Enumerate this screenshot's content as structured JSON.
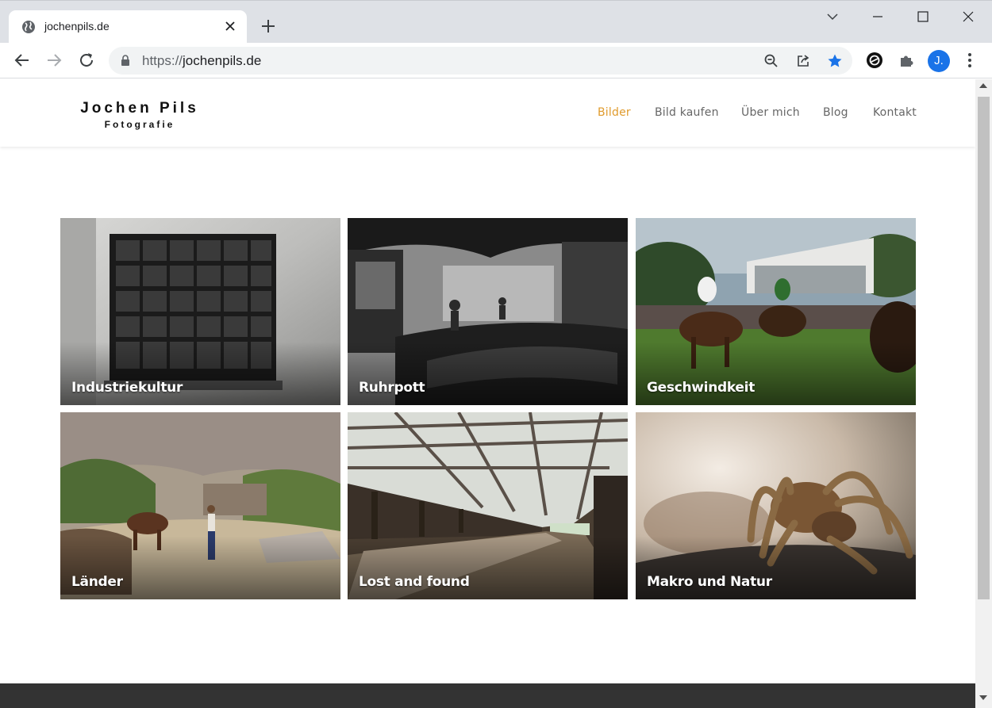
{
  "browser": {
    "tab_title": "jochenpils.de",
    "url_protocol": "https://",
    "url_host": "jochenpils.de",
    "avatar_letter": "J.",
    "icons": [
      "globe-icon",
      "close-icon",
      "plus-icon",
      "chevron-down-icon",
      "minimize-icon",
      "maximize-icon",
      "window-close-icon",
      "back-icon",
      "forward-icon",
      "reload-icon",
      "lock-icon",
      "zoom-icon",
      "share-icon",
      "star-icon",
      "extension-e-icon",
      "puzzle-icon",
      "kebab-menu-icon"
    ],
    "accent_color": "#1a73e8"
  },
  "site": {
    "logo_name": "Jochen Pils",
    "logo_sub": "Fotografie",
    "nav": [
      {
        "label": "Bilder",
        "active": true
      },
      {
        "label": "Bild kaufen",
        "active": false
      },
      {
        "label": "Über mich",
        "active": false
      },
      {
        "label": "Blog",
        "active": false
      },
      {
        "label": "Kontakt",
        "active": false
      }
    ],
    "active_color": "#e09b2d"
  },
  "gallery": [
    {
      "label": "Industriekultur"
    },
    {
      "label": "Ruhrpott"
    },
    {
      "label": "Geschwindkeit"
    },
    {
      "label": "Länder"
    },
    {
      "label": "Lost and found"
    },
    {
      "label": "Makro und Natur"
    }
  ]
}
